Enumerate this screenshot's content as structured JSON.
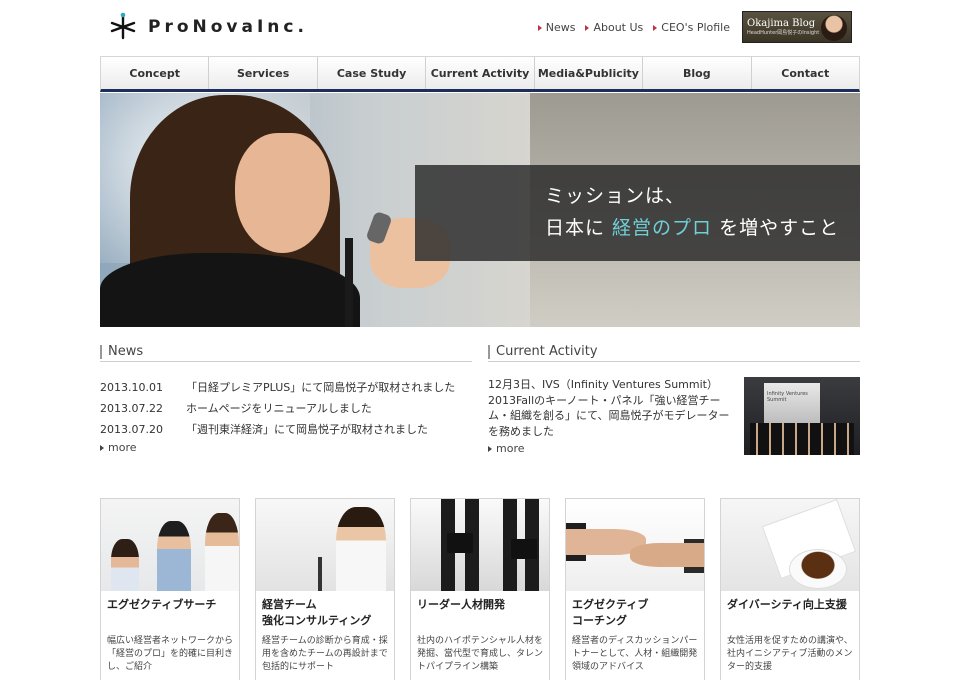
{
  "brand": {
    "name": "ProNovaInc."
  },
  "util_links": [
    "News",
    "About Us",
    "CEO's Plofile"
  ],
  "blog_badge": {
    "title": "Okajima Blog",
    "subtitle": "HeadHunter岡島悦子のInsight"
  },
  "nav": [
    "Concept",
    "Services",
    "Case Study",
    "Current Activity",
    "Media&Publicity",
    "Blog",
    "Contact"
  ],
  "hero": {
    "line1": "ミッションは、",
    "line2_prefix": "日本に ",
    "line2_accent": "経営のプロ",
    "line2_suffix": " を増やすこと"
  },
  "news": {
    "title": "News",
    "items": [
      {
        "date": "2013.10.01",
        "text": "「日経プレミアPLUS」にて岡島悦子が取材されました"
      },
      {
        "date": "2013.07.22",
        "text": "ホームページをリニューアルしました"
      },
      {
        "date": "2013.07.20",
        "text": "「週刊東洋経済」にて岡島悦子が取材されました"
      }
    ],
    "more": "more"
  },
  "activity": {
    "title": "Current Activity",
    "text": "12月3日、IVS（Infinity Ventures Summit）2013Fallのキーノート・パネル「強い経営チーム・組織を創る」にて、岡島悦子がモデレーターを務めました",
    "photo_caption": "Infinity Ventures Summit",
    "more": "more"
  },
  "cards": [
    {
      "title": "エグゼクティブサーチ",
      "desc": "幅広い経営者ネットワークから「経営のプロ」を的確に目利きし、ご紹介"
    },
    {
      "title": "経営チーム\n強化コンサルティング",
      "desc": "経営チームの診断から育成・採用を含めたチームの再設計まで包括的にサポート"
    },
    {
      "title": "リーダー人材開発",
      "desc": "社内のハイポテンシャル人材を発掘、當代型で育成し、タレントパイプライン構築"
    },
    {
      "title": "エグゼクティブ\nコーチング",
      "desc": "経営者のディスカッションパートナーとして、人材・組織開発領域のアドバイス"
    },
    {
      "title": "ダイバーシティ向上支援",
      "desc": "女性活用を促すための講演や、社内イニシアティブ活動のメンター的支援"
    }
  ],
  "colors": {
    "nav_border": "#1e2e5a",
    "accent_teal": "#6fd0d6",
    "link_marker": "#b34444"
  }
}
